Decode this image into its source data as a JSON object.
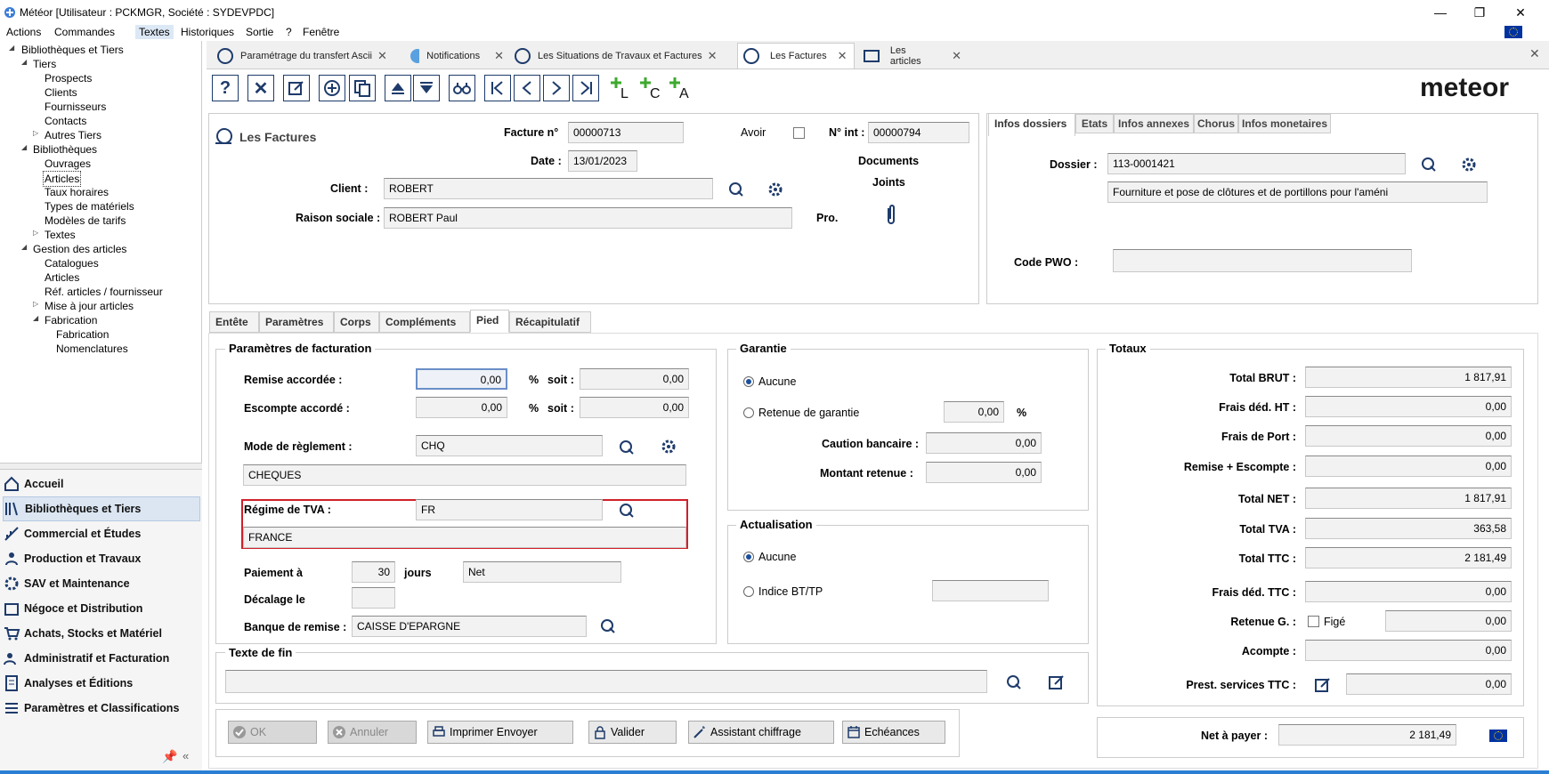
{
  "window": {
    "title": "Météor [Utilisateur : PCKMGR, Société : SYDEVPDC]"
  },
  "menu": [
    "Actions",
    "Commandes",
    "Textes",
    "Historiques",
    "Sortie",
    "?",
    "Fenêtre"
  ],
  "tree": [
    "Bibliothèques et Tiers",
    "Tiers",
    "Prospects",
    "Clients",
    "Fournisseurs",
    "Contacts",
    "Autres Tiers",
    "Bibliothèques",
    "Ouvrages",
    "Articles",
    "Taux horaires",
    "Types de matériels",
    "Modèles de tarifs",
    "Textes",
    "Gestion des articles",
    "Catalogues",
    "Articles",
    "Réf. articles / fournisseur",
    "Mise à jour articles",
    "Fabrication",
    "Fabrication",
    "Nomenclatures"
  ],
  "nav": [
    "Accueil",
    "Bibliothèques et Tiers",
    "Commercial et Études",
    "Production et Travaux",
    "SAV et Maintenance",
    "Négoce et Distribution",
    "Achats, Stocks et Matériel",
    "Administratif et Facturation",
    "Analyses et Éditions",
    "Paramètres et Classifications"
  ],
  "doc_tabs": [
    "Paramétrage du transfert Ascii",
    "Notifications",
    "Les Situations de Travaux et Factures",
    "Les Factures",
    "Les articles"
  ],
  "brand": "meteor",
  "form": {
    "title": "Les Factures",
    "facture_label": "Facture n°",
    "facture_no": "00000713",
    "avoir_label": "Avoir",
    "nint_label": "N° int :",
    "nint": "00000794",
    "date_label": "Date :",
    "date": "13/01/2023",
    "documents": "Documents",
    "joints": "Joints",
    "pro": "Pro.",
    "client_label": "Client :",
    "client": "ROBERT",
    "raison_label": "Raison sociale :",
    "raison": "ROBERT Paul"
  },
  "info_tabs": [
    "Infos dossiers",
    "Etats",
    "Infos annexes",
    "Chorus",
    "Infos monetaires"
  ],
  "dossier": {
    "label": "Dossier :",
    "value": "113-0001421",
    "desc": "Fourniture et pose de clôtures et de portillons pour l'améni",
    "pwo_label": "Code PWO :",
    "pwo": ""
  },
  "page_tabs": [
    "Entête",
    "Paramètres",
    "Corps",
    "Compléments",
    "Pied",
    "Récapitulatif"
  ],
  "params": {
    "legend": "Paramètres de facturation",
    "remise_label": "Remise accordée :",
    "remise": "0,00",
    "escompte_label": "Escompte accordé :",
    "escompte": "0,00",
    "pct": "%",
    "soit": "soit :",
    "remise_soit": "0,00",
    "escompte_soit": "0,00",
    "mode_label": "Mode de règlement :",
    "mode": "CHQ",
    "mode_desc": "CHEQUES",
    "tva_label": "Régime de TVA :",
    "tva": "FR",
    "tva_desc": "FRANCE",
    "paiement_label": "Paiement à",
    "paiement": "30",
    "jours": "jours",
    "net": "Net",
    "decalage_label": "Décalage le",
    "decalage": "",
    "banque_label": "Banque de remise :",
    "banque": "CAISSE D'EPARGNE"
  },
  "garantie": {
    "legend": "Garantie",
    "aucune": "Aucune",
    "retenue": "Retenue de garantie",
    "retenue_val": "0,00",
    "pct": "%",
    "caution_label": "Caution bancaire :",
    "caution": "0,00",
    "montant_label": "Montant retenue :",
    "montant": "0,00"
  },
  "actualisation": {
    "legend": "Actualisation",
    "aucune": "Aucune",
    "indice": "Indice BT/TP",
    "indice_val": ""
  },
  "texte_fin": {
    "legend": "Texte de fin",
    "value": ""
  },
  "totaux": {
    "legend": "Totaux",
    "rows": [
      {
        "label": "Total BRUT :",
        "value": "1 817,91"
      },
      {
        "label": "Frais déd. HT :",
        "value": "0,00"
      },
      {
        "label": "Frais de Port :",
        "value": "0,00"
      },
      {
        "label": "Remise + Escompte :",
        "value": "0,00"
      },
      {
        "label": "Total NET :",
        "value": "1 817,91"
      },
      {
        "label": "Total TVA :",
        "value": "363,58"
      },
      {
        "label": "Total TTC :",
        "value": "2 181,49"
      },
      {
        "label": "Frais déd. TTC :",
        "value": "0,00"
      },
      {
        "label": "Retenue G. :",
        "value": "0,00"
      },
      {
        "label": "Acompte :",
        "value": "0,00"
      },
      {
        "label": "Prest. services TTC :",
        "value": "0,00"
      }
    ],
    "fige": "Figé",
    "net_label": "Net à payer :",
    "net_value": "2 181,49"
  },
  "buttons": [
    "OK",
    "Annuler",
    "Imprimer Envoyer",
    "Valider",
    "Assistant chiffrage",
    "Echéances"
  ],
  "colors": {
    "accent": "#1e3b6b",
    "highlight": "#d0202a"
  }
}
